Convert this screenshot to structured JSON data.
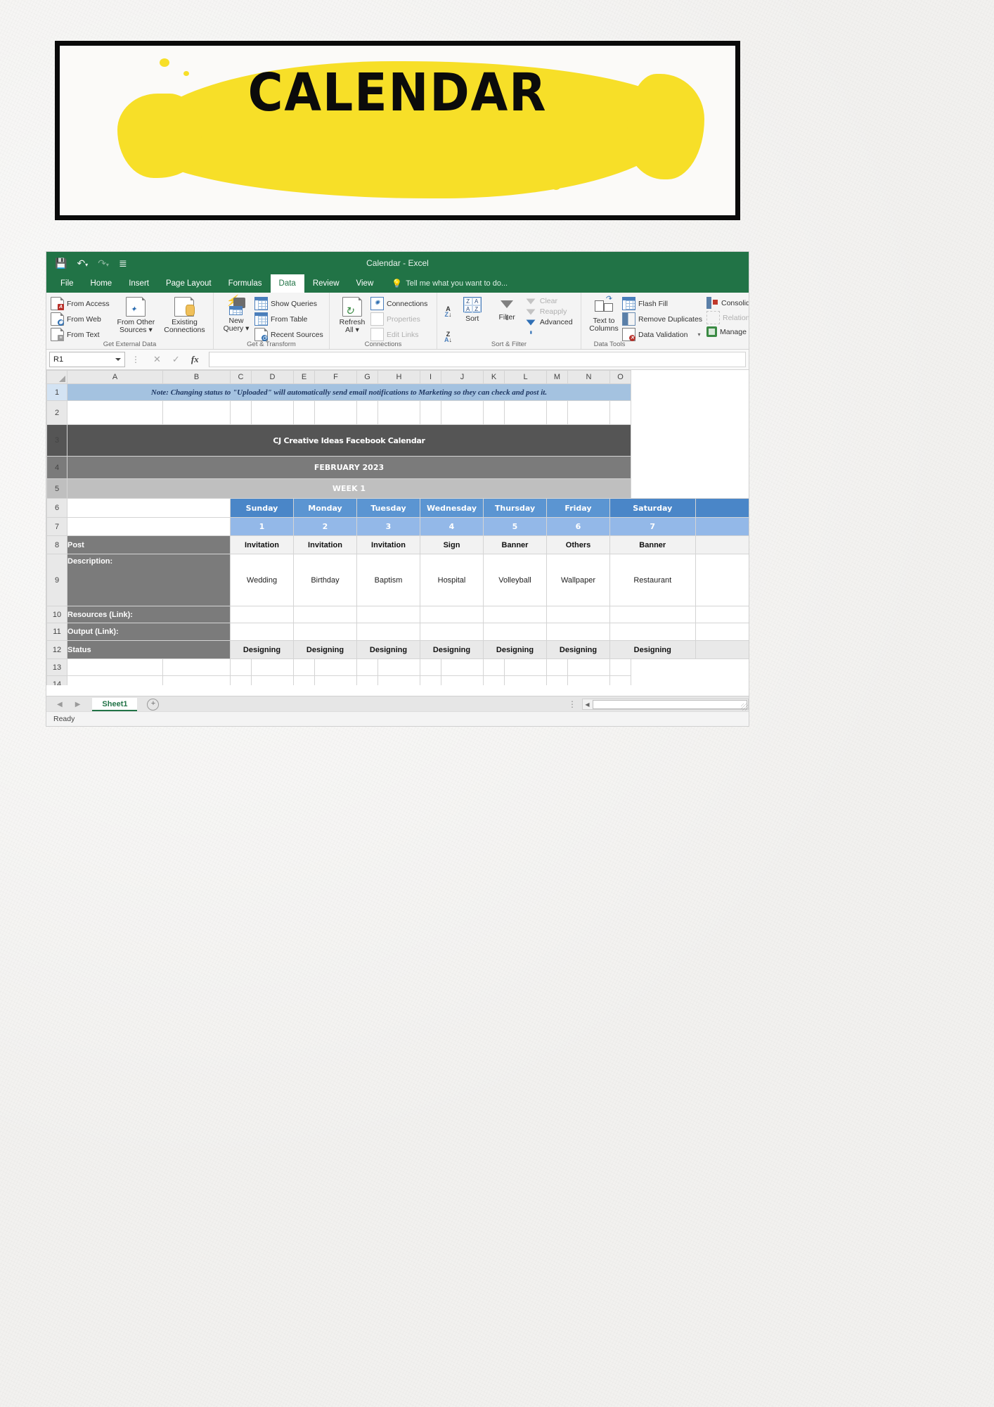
{
  "banner": {
    "title": "CALENDAR"
  },
  "window": {
    "app_title": "Calendar - Excel",
    "qat": [
      {
        "name": "save-icon",
        "glyph": "ὋE"
      },
      {
        "name": "undo-icon",
        "glyph": "↶"
      },
      {
        "name": "redo-icon",
        "glyph": "↷"
      },
      {
        "name": "customize-qat-icon",
        "glyph": "☰"
      }
    ]
  },
  "tabs": [
    {
      "label": "File",
      "active": false
    },
    {
      "label": "Home",
      "active": false
    },
    {
      "label": "Insert",
      "active": false
    },
    {
      "label": "Page Layout",
      "active": false
    },
    {
      "label": "Formulas",
      "active": false
    },
    {
      "label": "Data",
      "active": true
    },
    {
      "label": "Review",
      "active": false
    },
    {
      "label": "View",
      "active": false
    }
  ],
  "tell_me": {
    "placeholder": "Tell me what you want to do..."
  },
  "ribbon": {
    "groups": [
      {
        "label": "Get External Data",
        "small": [
          "From Access",
          "From Web",
          "From Text"
        ],
        "big": [
          "From Other Sources ▾",
          "Existing Connections"
        ]
      },
      {
        "label": "Get & Transform",
        "big": [
          "New Query ▾"
        ],
        "small": [
          "Show Queries",
          "From Table",
          "Recent Sources"
        ]
      },
      {
        "label": "Connections",
        "big": [
          "Refresh All ▾"
        ],
        "small": [
          "Connections",
          "Properties",
          "Edit Links"
        ]
      },
      {
        "label": "Sort & Filter",
        "small": [
          "Clear",
          "Reapply",
          "Advanced"
        ],
        "big": [
          "Sort",
          "Filter"
        ]
      },
      {
        "label": "Data Tools",
        "big": [
          "Text to Columns"
        ],
        "small": [
          "Flash Fill",
          "Remove Duplicates",
          "Data Validation  ▾",
          "Consolidate",
          "Relationships",
          "Manage Data Model"
        ]
      }
    ],
    "labels": {
      "get_external_data": "Get External Data",
      "get_transform": "Get & Transform",
      "connections": "Connections",
      "sort_filter": "Sort & Filter",
      "data_tools": "Data Tools"
    },
    "buttons": {
      "from_access": "From Access",
      "from_web": "From Web",
      "from_text": "From Text",
      "from_other_sources_l1": "From Other",
      "from_other_sources_l2": "Sources ▾",
      "existing_connections_l1": "Existing",
      "existing_connections_l2": "Connections",
      "new_query_l1": "New",
      "new_query_l2": "Query ▾",
      "show_queries": "Show Queries",
      "from_table": "From Table",
      "recent_sources": "Recent Sources",
      "refresh_all_l1": "Refresh",
      "refresh_all_l2": "All ▾",
      "connections": "Connections",
      "properties": "Properties",
      "edit_links": "Edit Links",
      "sort": "Sort",
      "filter": "Filter",
      "clear": "Clear",
      "reapply": "Reapply",
      "advanced": "Advanced",
      "text_to_columns_l1": "Text to",
      "text_to_columns_l2": "Columns",
      "flash_fill": "Flash Fill",
      "remove_duplicates": "Remove Duplicates",
      "data_validation": "Data Validation",
      "consolidate": "Consolidate",
      "relationships": "Relationships",
      "manage_data_model": "Manage Data Model"
    }
  },
  "formula_bar": {
    "name_box": "R1",
    "formula_value": "",
    "cancel_icon": "✕",
    "enter_icon": "✓",
    "fx_icon": "fx"
  },
  "grid": {
    "columns": [
      "A",
      "B",
      "C",
      "D",
      "E",
      "F",
      "G",
      "H",
      "I",
      "J",
      "K",
      "L",
      "M",
      "N",
      "O"
    ],
    "row_numbers": [
      "1",
      "2",
      "3",
      "4",
      "5",
      "6",
      "7",
      "8",
      "9",
      "10",
      "11",
      "12",
      "13",
      "14"
    ],
    "selected_row": "1"
  },
  "sheet_content": {
    "note": "Note: Changing status to \"Uploaded\" will automatically send email notifications to Marketing so they can check and post it.",
    "title": "CJ Creative Ideas Facebook Calendar",
    "month": "FEBRUARY 2023",
    "week": "WEEK 1",
    "day_names": [
      "Sunday",
      "Monday",
      "Tuesday",
      "Wednesday",
      "Thursday",
      "Friday",
      "Saturday"
    ],
    "day_numbers": [
      "1",
      "2",
      "3",
      "4",
      "5",
      "6",
      "7"
    ],
    "row_labels": {
      "post": "Post",
      "description": "Description:",
      "resources": "Resources (Link):",
      "output": "Output (Link):",
      "status": "Status"
    },
    "posts": [
      "Invitation",
      "Invitation",
      "Invitation",
      "Sign",
      "Banner",
      "Others",
      "Banner"
    ],
    "descriptions": [
      "Wedding",
      "Birthday",
      "Baptism",
      "Hospital",
      "Volleyball",
      "Wallpaper",
      "Restaurant"
    ],
    "resources": [
      "",
      "",
      "",
      "",
      "",
      "",
      ""
    ],
    "outputs": [
      "",
      "",
      "",
      "",
      "",
      "",
      ""
    ],
    "statuses": [
      "Designing",
      "Designing",
      "Designing",
      "Designing",
      "Designing",
      "Designing",
      "Designing"
    ]
  },
  "sheet_tabs": {
    "prev_icon": "◀",
    "next_icon": "▶",
    "tabs": [
      "Sheet1"
    ],
    "add_sheet_icon": "+"
  },
  "status_bar": {
    "text": "Ready"
  },
  "colors": {
    "excel_green": "#217346",
    "note_blue": "#a4c2e0",
    "title_gray": "#555555",
    "month_gray": "#7b7b7b",
    "week_gray": "#bfbfbf",
    "day_blue": "#4a86c8",
    "daynum_blue": "#93b8e8",
    "label_gray": "#7b7b7b",
    "brush_yellow": "#f7df28"
  }
}
